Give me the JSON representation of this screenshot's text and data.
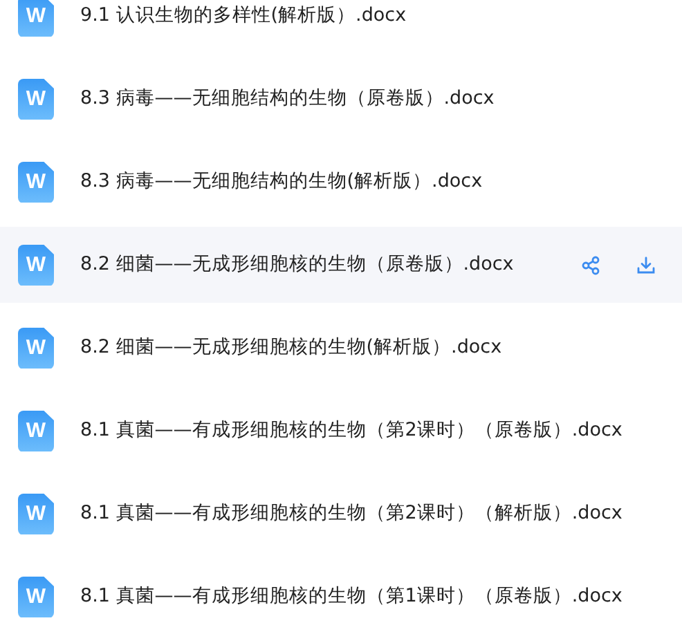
{
  "files": [
    {
      "icon_letter": "W",
      "name": "9.1 认识生物的多样性(解析版）.docx",
      "selected": false
    },
    {
      "icon_letter": "W",
      "name": "8.3 病毒——无细胞结构的生物（原卷版）.docx",
      "selected": false
    },
    {
      "icon_letter": "W",
      "name": "8.3 病毒——无细胞结构的生物(解析版）.docx",
      "selected": false
    },
    {
      "icon_letter": "W",
      "name": "8.2 细菌——无成形细胞核的生物（原卷版）.docx",
      "selected": true
    },
    {
      "icon_letter": "W",
      "name": "8.2 细菌——无成形细胞核的生物(解析版）.docx",
      "selected": false
    },
    {
      "icon_letter": "W",
      "name": "8.1 真菌——有成形细胞核的生物（第2课时）（原卷版）.docx",
      "selected": false
    },
    {
      "icon_letter": "W",
      "name": "8.1 真菌——有成形细胞核的生物（第2课时）（解析版）.docx",
      "selected": false
    },
    {
      "icon_letter": "W",
      "name": "8.1 真菌——有成形细胞核的生物（第1课时）（原卷版）.docx",
      "selected": false
    }
  ]
}
